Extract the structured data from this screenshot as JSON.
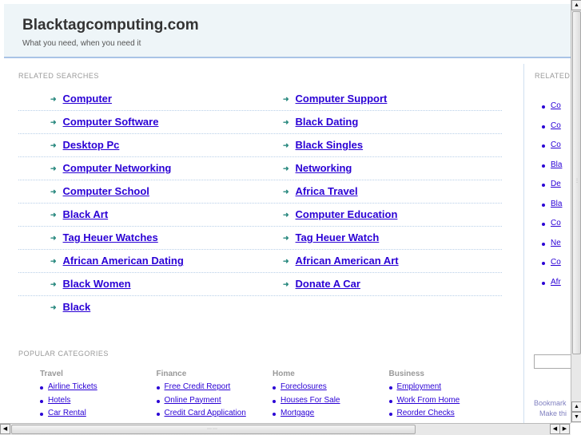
{
  "header": {
    "title": "Blacktagcomputing.com",
    "tagline": "What you need, when you need it"
  },
  "related": {
    "label": "RELATED SEARCHES",
    "rows": [
      [
        "Computer",
        "Computer Support"
      ],
      [
        "Computer Software",
        "Black Dating"
      ],
      [
        "Desktop Pc",
        "Black Singles"
      ],
      [
        "Computer Networking",
        "Networking"
      ],
      [
        "Computer School",
        "Africa Travel"
      ],
      [
        "Black Art",
        "Computer Education"
      ],
      [
        "Tag Heuer Watches",
        "Tag Heuer Watch"
      ],
      [
        "African American Dating",
        "African American Art"
      ],
      [
        "Black Women",
        "Donate A Car"
      ],
      [
        "Black",
        null
      ]
    ]
  },
  "popular": {
    "label": "POPULAR CATEGORIES",
    "categories": [
      {
        "title": "Travel",
        "links": [
          "Airline Tickets",
          "Hotels",
          "Car Rental"
        ]
      },
      {
        "title": "Finance",
        "links": [
          "Free Credit Report",
          "Online Payment",
          "Credit Card Application"
        ]
      },
      {
        "title": "Home",
        "links": [
          "Foreclosures",
          "Houses For Sale",
          "Mortgage"
        ]
      },
      {
        "title": "Business",
        "links": [
          "Employment",
          "Work From Home",
          "Reorder Checks"
        ]
      }
    ]
  },
  "sidebar": {
    "label": "RELATED",
    "links": [
      "Co",
      "Co",
      "Co",
      "Bla",
      "De",
      "Bla",
      "Co",
      "Ne",
      "Co",
      "Afr"
    ],
    "bookmark": "Bookmark",
    "make": "Make thi"
  }
}
